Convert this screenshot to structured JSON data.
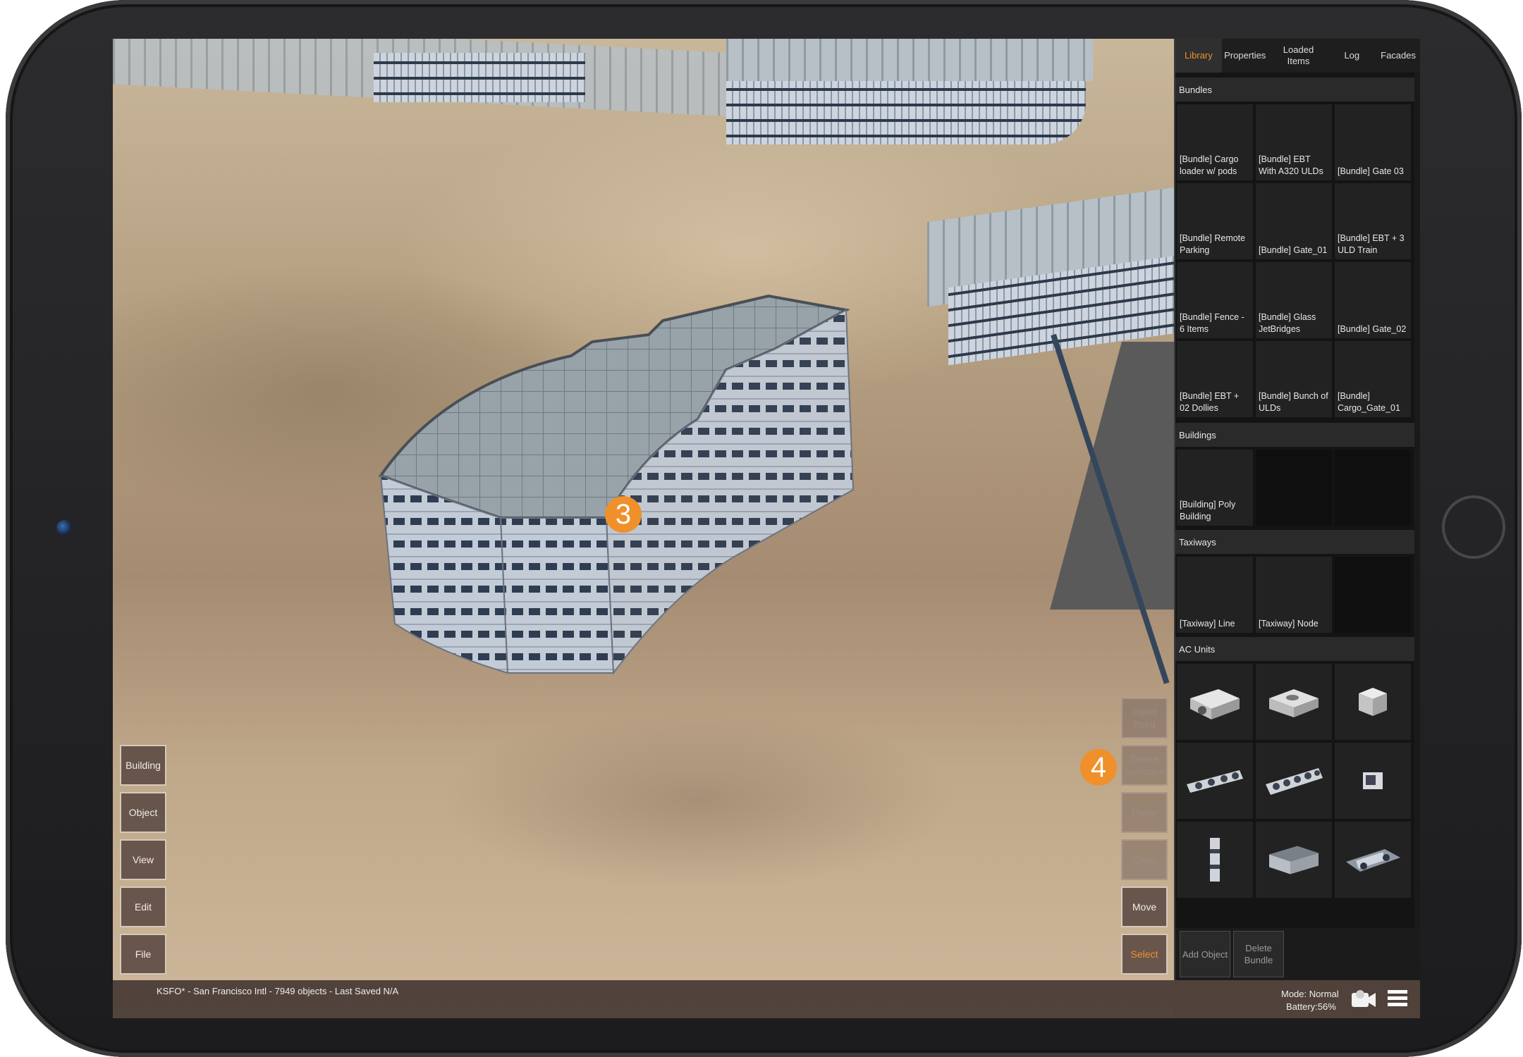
{
  "panel": {
    "tabs": [
      {
        "label": "Library"
      },
      {
        "label": "Properties"
      },
      {
        "label": "Loaded Items"
      },
      {
        "label": "Log"
      },
      {
        "label": "Facades"
      }
    ],
    "sections": {
      "bundles": "Bundles",
      "buildings": "Buildings",
      "taxiways": "Taxiways",
      "ac_units": "AC Units"
    },
    "bundles": [
      "[Bundle] Cargo loader w/ pods",
      "[Bundle] EBT With A320 ULDs",
      "[Bundle] Gate 03",
      "[Bundle] Remote Parking",
      "[Bundle] Gate_01",
      "[Bundle] EBT + 3 ULD Train",
      "[Bundle] Fence - 6 Items",
      "[Bundle] Glass JetBridges",
      "[Bundle] Gate_02",
      "[Bundle] EBT + 02 Dollies",
      "[Bundle] Bunch of ULDs",
      "[Bundle] Cargo_Gate_01"
    ],
    "buildings": [
      "[Building] Poly Building"
    ],
    "taxiways": [
      "[Taxiway] Line",
      "[Taxiway] Node"
    ],
    "ac_units_icons": [
      "ac-unit-1-icon",
      "ac-unit-2-icon",
      "ac-unit-3-icon",
      "ac-unit-4-icon",
      "ac-unit-5-icon",
      "ac-unit-6-icon",
      "ac-unit-7-icon",
      "ac-unit-8-icon",
      "ac-unit-9-icon"
    ],
    "add_object": "Add Object",
    "delete_bundle": "Delete Bundle"
  },
  "left_toolbar": {
    "building": "Building",
    "object": "Object",
    "view": "View",
    "edit": "Edit",
    "file": "File"
  },
  "right_toolbar": {
    "insert_point": "Insert Point",
    "delete_selection": "Delete Selection",
    "paste": "Paste",
    "copy": "Copy",
    "move": "Move",
    "select": "Select"
  },
  "callouts": {
    "three": "3",
    "four": "4"
  },
  "status": {
    "info": "KSFO* - San Francisco Intl - 7949 objects - Last Saved N/A",
    "mode": "Mode: Normal",
    "battery": "Battery:56%"
  },
  "colors": {
    "accent": "#f0902a",
    "panel_bg": "#141414",
    "toolbar_bg": "#5f4e46"
  }
}
